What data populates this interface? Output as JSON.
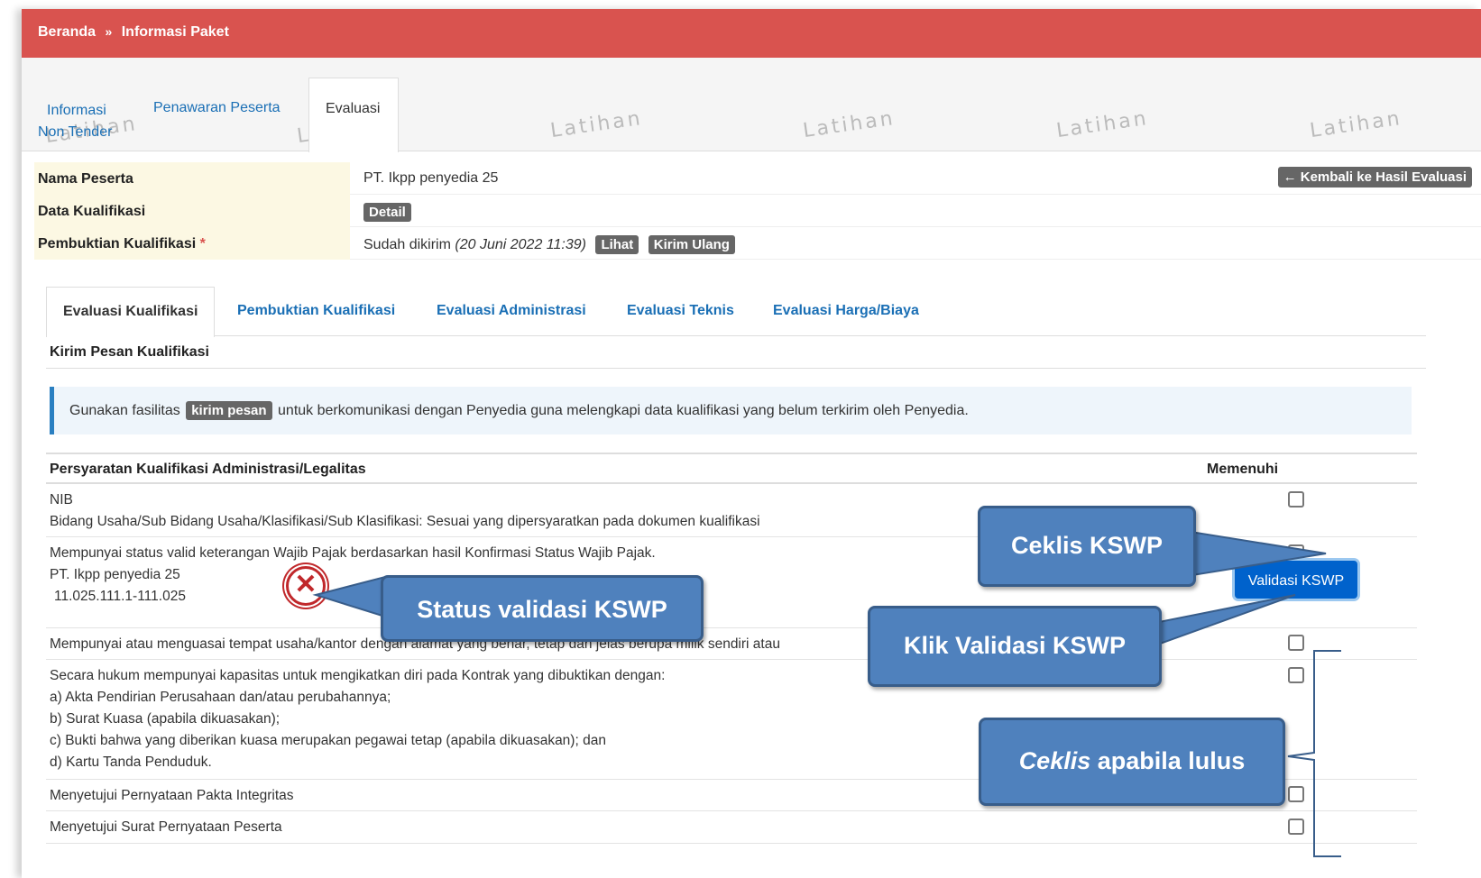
{
  "breadcrumb": {
    "home": "Beranda",
    "separator": "»",
    "current": "Informasi Paket"
  },
  "tabs": {
    "informasi_line1": "Informasi",
    "informasi_line2": "Non Tender",
    "penawaran": "Penawaran Peserta",
    "evaluasi": "Evaluasi"
  },
  "watermark": "Latihan",
  "info": {
    "nama_label": "Nama Peserta",
    "nama_value": "PT. Ikpp penyedia 25",
    "back_button": "Kembali ke Hasil Evaluasi",
    "kualifikasi_label": "Data Kualifikasi",
    "detail_button": "Detail",
    "pembuktian_label": "Pembuktian Kualifikasi",
    "required_mark": "*",
    "pembuktian_status": "Sudah dikirim",
    "pembuktian_date": "(20 Juni 2022 11:39)",
    "lihat_button": "Lihat",
    "kirim_ulang_button": "Kirim Ulang"
  },
  "subtabs": [
    "Evaluasi Kualifikasi",
    "Pembuktian Kualifikasi",
    "Evaluasi Administrasi",
    "Evaluasi Teknis",
    "Evaluasi Harga/Biaya"
  ],
  "section_title": "Kirim Pesan Kualifikasi",
  "alert": {
    "before": "Gunakan fasilitas",
    "badge": "kirim pesan",
    "after": "untuk berkomunikasi dengan Penyedia guna melengkapi data kualifikasi yang belum terkirim oleh Penyedia."
  },
  "requirements": {
    "header_left": "Persyaratan Kualifikasi Administrasi/Legalitas",
    "header_right": "Memenuhi",
    "nib_line1": "NIB",
    "nib_line2": "Bidang Usaha/Sub Bidang Usaha/Klasifikasi/Sub Klasifikasi: Sesuai yang dipersyaratkan pada dokumen kualifikasi",
    "kswp_line1": "Mempunyai status valid keterangan Wajib Pajak berdasarkan hasil Konfirmasi Status Wajib Pajak.",
    "kswp_company": "PT. Ikpp penyedia 25",
    "kswp_npwp": "11.025.111.1-111.025",
    "kswp_status_icon": "x-circle-icon",
    "validasi_button": "Validasi KSWP",
    "tempat_usaha": "Mempunyai atau menguasai tempat usaha/kantor dengan alamat yang benar, tetap dan jelas berupa milik sendiri atau",
    "hukum_line1": "Secara hukum mempunyai kapasitas untuk mengikatkan diri pada Kontrak yang dibuktikan dengan:",
    "hukum_line2": "a) Akta Pendirian Perusahaan dan/atau perubahannya;",
    "hukum_line3": "b) Surat Kuasa (apabila dikuasakan);",
    "hukum_line4": "c) Bukti bahwa yang diberikan kuasa merupakan pegawai tetap (apabila dikuasakan); dan",
    "hukum_line5": "d) Kartu Tanda Penduduk.",
    "pakta": "Menyetujui Pernyataan Pakta Integritas",
    "peserta": "Menyetujui Surat Pernyataan Peserta"
  },
  "callouts": {
    "ceklis_kswp": "Ceklis KSWP",
    "status_validasi": "Status validasi KSWP",
    "klik_validasi": "Klik Validasi KSWP",
    "ceklis_word": "Ceklis",
    "apabila_lulus": " apabila lulus"
  },
  "colors": {
    "header_red": "#d9534f",
    "link_blue": "#1a6fb5",
    "callout_blue": "#4f81bd",
    "button_blue": "#0062cc",
    "label_bg": "#fcf8e3"
  }
}
